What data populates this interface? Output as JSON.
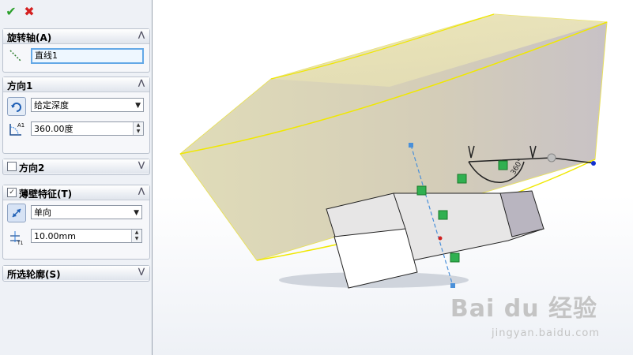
{
  "panel": {
    "rotation_axis": {
      "title": "旋转轴(A)",
      "axis_value": "直线1"
    },
    "direction1": {
      "title": "方向1",
      "end_condition": "给定深度",
      "angle_value": "360.00度",
      "angle_icon_label": "A1"
    },
    "direction2": {
      "title": "方向2"
    },
    "thin_feature": {
      "title": "薄壁特征(T)",
      "type_value": "单向",
      "thickness_value": "10.00mm",
      "thickness_icon_label": "T1"
    },
    "selected_contours": {
      "title": "所选轮廓(S)"
    }
  },
  "viewport": {
    "angle_label": "360°"
  },
  "watermark": {
    "brand": "Bai du 经验",
    "url": "jingyan.baidu.com"
  },
  "colors": {
    "confirm": "#2ca02c",
    "cancel": "#d42020",
    "selection_outline": "#ffff00",
    "axis_line": "#4a90d9"
  }
}
